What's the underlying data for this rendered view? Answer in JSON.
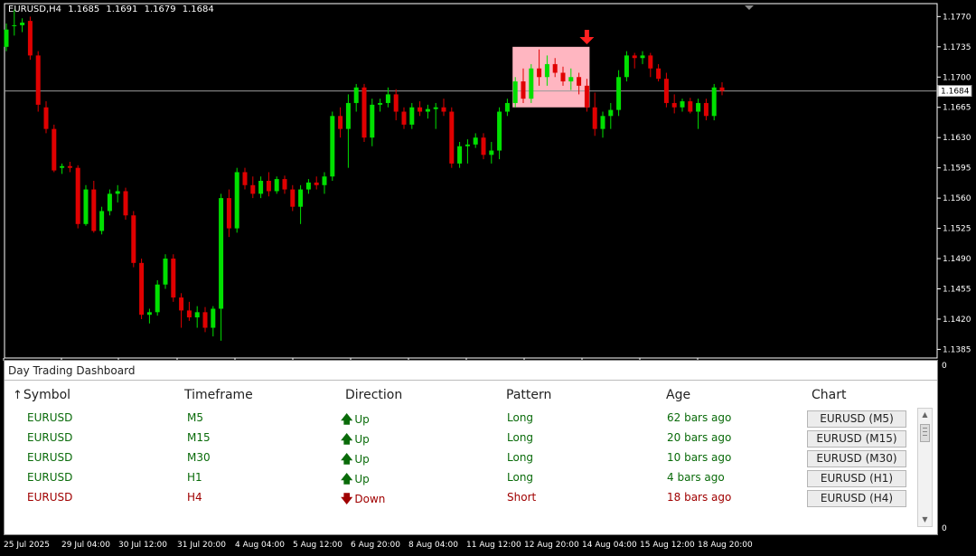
{
  "chart": {
    "symbol_tf": "EURUSD,H4",
    "ohlc": [
      "1.1685",
      "1.1691",
      "1.1679",
      "1.1684"
    ],
    "current_price": "1.1684",
    "colors": {
      "bull": "#00e000",
      "bear": "#e00000",
      "pattern_box": "#ffb6c1",
      "arrow": "#ff2020"
    },
    "price_ticks": [
      "1.1770",
      "1.1735",
      "1.1700",
      "1.1665",
      "1.1630",
      "1.1595",
      "1.1560",
      "1.1525",
      "1.1490",
      "1.1455",
      "1.1420",
      "1.1385"
    ],
    "time_ticks": [
      "25 Jul 2025",
      "29 Jul 04:00",
      "30 Jul 12:00",
      "31 Jul 20:00",
      "4 Aug 04:00",
      "5 Aug 12:00",
      "6 Aug 20:00",
      "8 Aug 04:00",
      "11 Aug 12:00",
      "12 Aug 20:00",
      "14 Aug 04:00",
      "15 Aug 12:00",
      "18 Aug 20:00"
    ],
    "indicator_zero_labels": [
      "0",
      "0"
    ],
    "candles": [
      [
        1.1735,
        1.1762,
        1.173,
        1.1755
      ],
      [
        1.176,
        1.1778,
        1.1748,
        1.176
      ],
      [
        1.176,
        1.1768,
        1.1752,
        1.1763
      ],
      [
        1.1765,
        1.177,
        1.172,
        1.1725
      ],
      [
        1.1725,
        1.173,
        1.166,
        1.1668
      ],
      [
        1.1665,
        1.1672,
        1.1635,
        1.164
      ],
      [
        1.164,
        1.1645,
        1.159,
        1.1592
      ],
      [
        1.1595,
        1.16,
        1.1588,
        1.1597
      ],
      [
        1.1597,
        1.1602,
        1.159,
        1.1595
      ],
      [
        1.1595,
        1.1598,
        1.1525,
        1.153
      ],
      [
        1.153,
        1.1575,
        1.1528,
        1.157
      ],
      [
        1.157,
        1.158,
        1.152,
        1.1522
      ],
      [
        1.1522,
        1.155,
        1.1518,
        1.1545
      ],
      [
        1.1545,
        1.157,
        1.154,
        1.1565
      ],
      [
        1.1565,
        1.1575,
        1.1555,
        1.1568
      ],
      [
        1.1568,
        1.1572,
        1.1535,
        1.154
      ],
      [
        1.154,
        1.1545,
        1.148,
        1.1485
      ],
      [
        1.1485,
        1.149,
        1.142,
        1.1425
      ],
      [
        1.1425,
        1.1432,
        1.1415,
        1.1428
      ],
      [
        1.1428,
        1.1465,
        1.1424,
        1.146
      ],
      [
        1.146,
        1.1495,
        1.1455,
        1.149
      ],
      [
        1.149,
        1.1495,
        1.144,
        1.1445
      ],
      [
        1.1445,
        1.145,
        1.141,
        1.143
      ],
      [
        1.143,
        1.144,
        1.1418,
        1.1422
      ],
      [
        1.1422,
        1.1435,
        1.141,
        1.1428
      ],
      [
        1.1428,
        1.1434,
        1.1405,
        1.141
      ],
      [
        1.141,
        1.1435,
        1.14,
        1.1432
      ],
      [
        1.1432,
        1.1565,
        1.1395,
        1.156
      ],
      [
        1.156,
        1.157,
        1.1515,
        1.1525
      ],
      [
        1.1525,
        1.1595,
        1.152,
        1.159
      ],
      [
        1.159,
        1.1595,
        1.157,
        1.1575
      ],
      [
        1.1575,
        1.1585,
        1.156,
        1.1565
      ],
      [
        1.1565,
        1.1585,
        1.156,
        1.158
      ],
      [
        1.158,
        1.159,
        1.1562,
        1.1568
      ],
      [
        1.1568,
        1.1585,
        1.1565,
        1.1582
      ],
      [
        1.1582,
        1.1586,
        1.1565,
        1.157
      ],
      [
        1.157,
        1.1575,
        1.1545,
        1.155
      ],
      [
        1.155,
        1.1575,
        1.153,
        1.157
      ],
      [
        1.157,
        1.1582,
        1.1565,
        1.1578
      ],
      [
        1.1578,
        1.1585,
        1.157,
        1.1575
      ],
      [
        1.1575,
        1.159,
        1.1565,
        1.1585
      ],
      [
        1.1585,
        1.166,
        1.158,
        1.1655
      ],
      [
        1.1655,
        1.1665,
        1.163,
        1.164
      ],
      [
        1.164,
        1.168,
        1.1595,
        1.167
      ],
      [
        1.167,
        1.1692,
        1.166,
        1.1688
      ],
      [
        1.1688,
        1.1692,
        1.1625,
        1.163
      ],
      [
        1.163,
        1.1675,
        1.162,
        1.1668
      ],
      [
        1.1668,
        1.1675,
        1.166,
        1.167
      ],
      [
        1.167,
        1.1688,
        1.1665,
        1.168
      ],
      [
        1.168,
        1.1686,
        1.165,
        1.166
      ],
      [
        1.166,
        1.1665,
        1.164,
        1.1645
      ],
      [
        1.1645,
        1.167,
        1.164,
        1.1665
      ],
      [
        1.1665,
        1.1672,
        1.1655,
        1.166
      ],
      [
        1.166,
        1.1668,
        1.1652,
        1.1663
      ],
      [
        1.1663,
        1.167,
        1.164,
        1.1665
      ],
      [
        1.1665,
        1.1675,
        1.1655,
        1.166
      ],
      [
        1.166,
        1.1665,
        1.1595,
        1.16
      ],
      [
        1.16,
        1.1625,
        1.1595,
        1.162
      ],
      [
        1.162,
        1.1628,
        1.16,
        1.1622
      ],
      [
        1.1622,
        1.1635,
        1.1618,
        1.163
      ],
      [
        1.163,
        1.1635,
        1.1605,
        1.161
      ],
      [
        1.161,
        1.1625,
        1.16,
        1.1615
      ],
      [
        1.1615,
        1.1665,
        1.1605,
        1.166
      ],
      [
        1.166,
        1.1675,
        1.1655,
        1.167
      ],
      [
        1.167,
        1.17,
        1.1665,
        1.1695
      ],
      [
        1.1695,
        1.171,
        1.167,
        1.1675
      ],
      [
        1.1675,
        1.1715,
        1.167,
        1.171
      ],
      [
        1.171,
        1.1732,
        1.169,
        1.17
      ],
      [
        1.17,
        1.1725,
        1.169,
        1.1715
      ],
      [
        1.1715,
        1.1722,
        1.17,
        1.1705
      ],
      [
        1.1705,
        1.1712,
        1.169,
        1.1695
      ],
      [
        1.1695,
        1.171,
        1.1685,
        1.17
      ],
      [
        1.17,
        1.1705,
        1.168,
        1.169
      ],
      [
        1.169,
        1.1698,
        1.166,
        1.1665
      ],
      [
        1.1665,
        1.1682,
        1.1632,
        1.164
      ],
      [
        1.164,
        1.166,
        1.163,
        1.1655
      ],
      [
        1.1655,
        1.167,
        1.164,
        1.1662
      ],
      [
        1.1662,
        1.1708,
        1.1655,
        1.17
      ],
      [
        1.17,
        1.173,
        1.1695,
        1.1725
      ],
      [
        1.1725,
        1.1728,
        1.171,
        1.1722
      ],
      [
        1.1722,
        1.173,
        1.1715,
        1.1725
      ],
      [
        1.1725,
        1.1728,
        1.17,
        1.171
      ],
      [
        1.171,
        1.1715,
        1.1695,
        1.1698
      ],
      [
        1.1698,
        1.1705,
        1.1665,
        1.167
      ],
      [
        1.167,
        1.168,
        1.1658,
        1.1665
      ],
      [
        1.1665,
        1.1675,
        1.166,
        1.1672
      ],
      [
        1.1672,
        1.1676,
        1.1658,
        1.166
      ],
      [
        1.166,
        1.1675,
        1.164,
        1.167
      ],
      [
        1.167,
        1.1675,
        1.165,
        1.1655
      ],
      [
        1.1655,
        1.1692,
        1.165,
        1.1688
      ],
      [
        1.1688,
        1.1694,
        1.1679,
        1.1684
      ]
    ],
    "pattern_box": {
      "from_bar": 64,
      "to_bar": 73,
      "high": 1.1735,
      "low": 1.1665
    },
    "signal_arrow_bar": 73,
    "signal_arrow_price": 1.174
  },
  "dashboard": {
    "title": "Day Trading Dashboard",
    "columns": [
      "Symbol",
      "Timeframe",
      "Direction",
      "Pattern",
      "Age",
      "Chart"
    ],
    "sort_icon": "↑",
    "rows": [
      {
        "symbol": "EURUSD",
        "timeframe": "M5",
        "direction": "Up",
        "dir_icon": "🡅",
        "pattern": "Long",
        "age": "62 bars ago",
        "chart_btn": "EURUSD (M5)",
        "trend": "up"
      },
      {
        "symbol": "EURUSD",
        "timeframe": "M15",
        "direction": "Up",
        "dir_icon": "🡅",
        "pattern": "Long",
        "age": "20 bars ago",
        "chart_btn": "EURUSD (M15)",
        "trend": "up"
      },
      {
        "symbol": "EURUSD",
        "timeframe": "M30",
        "direction": "Up",
        "dir_icon": "🡅",
        "pattern": "Long",
        "age": "10 bars ago",
        "chart_btn": "EURUSD (M30)",
        "trend": "up"
      },
      {
        "symbol": "EURUSD",
        "timeframe": "H1",
        "direction": "Up",
        "dir_icon": "🡅",
        "pattern": "Long",
        "age": "4 bars ago",
        "chart_btn": "EURUSD (H1)",
        "trend": "up"
      },
      {
        "symbol": "EURUSD",
        "timeframe": "H4",
        "direction": "Down",
        "dir_icon": "🡇",
        "pattern": "Short",
        "age": "18 bars ago",
        "chart_btn": "EURUSD (H4)",
        "trend": "down"
      }
    ]
  }
}
